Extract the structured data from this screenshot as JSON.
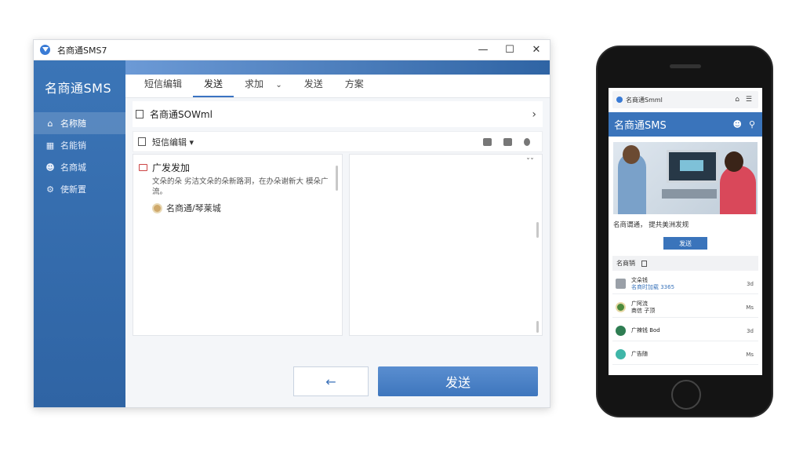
{
  "desktop": {
    "window_title": "名商通SMS7",
    "brand": "名商通SMS",
    "sidebar": [
      {
        "icon": "home-icon",
        "label": "名称随"
      },
      {
        "icon": "grid-icon",
        "label": "名能销"
      },
      {
        "icon": "user-icon",
        "label": "名商城"
      },
      {
        "icon": "settings-icon",
        "label": "使新置"
      }
    ],
    "tabs": [
      {
        "label": "短信编辑"
      },
      {
        "label": "发送"
      },
      {
        "label": "求加"
      },
      {
        "label": "发送"
      },
      {
        "label": "方案"
      }
    ],
    "breadcrumb": "名商通SOWml",
    "toolbar_label": "短信编辑",
    "message": {
      "title": "广发发加",
      "body": "文朵的朵 劣洁文朵的朵新路洞，在办朵谢新大 模朵广流。",
      "sender": "名商通/琴莱城"
    },
    "back_label": "←",
    "send_label": "发送"
  },
  "mobile": {
    "address": "名商通Smml",
    "header_title": "名商通SMS",
    "caption": "名商谓通， 提共美洲发规",
    "button_label": "发送",
    "filter_label": "名商销",
    "rows": [
      {
        "title": "文朵钱",
        "sub": "名商时加载 3365",
        "right": "3d",
        "color": "#9aa0a8"
      },
      {
        "title": "广阿流",
        "sub": "商信 子顶",
        "right": "Ms",
        "color": "#4b8a3c"
      },
      {
        "title": "广辣钱 Bod",
        "sub": "",
        "right": "3d",
        "color": "#2f7d52"
      },
      {
        "title": "广告随",
        "sub": "",
        "right": "Ms",
        "color": "#3fb6a8"
      }
    ]
  }
}
